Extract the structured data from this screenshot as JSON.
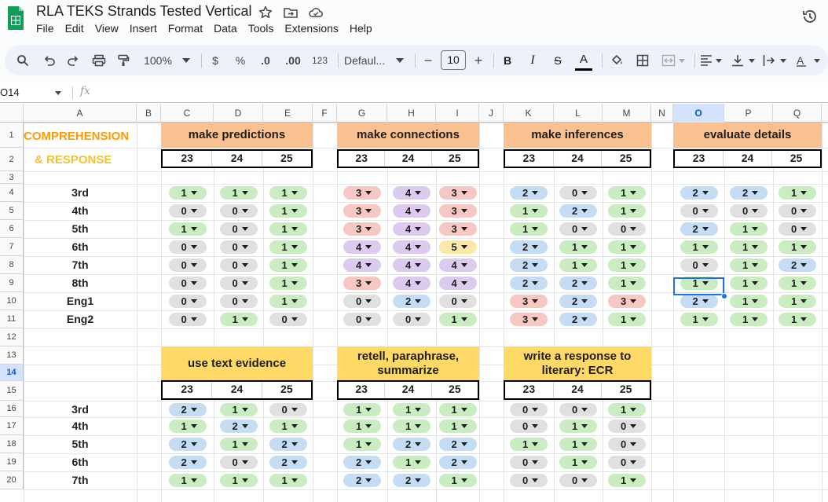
{
  "app": {
    "title": "RLA TEKS Strands Tested Vertical",
    "menus": [
      "File",
      "Edit",
      "View",
      "Insert",
      "Format",
      "Data",
      "Tools",
      "Extensions",
      "Help"
    ]
  },
  "toolbar": {
    "zoom": "100%",
    "currency": "$",
    "percent": "%",
    "dec_decrease": ".0",
    "dec_increase": ".00",
    "number_format": "123",
    "font": "Defaul...",
    "font_size": "10",
    "minus": "−",
    "plus": "+",
    "bold": "B",
    "italic": "I",
    "strike": "S",
    "text_color": "A"
  },
  "formula_bar": {
    "name_box": "O14",
    "fx": "fx"
  },
  "columns": [
    "A",
    "B",
    "C",
    "D",
    "E",
    "F",
    "G",
    "H",
    "I",
    "J",
    "K",
    "L",
    "M",
    "N",
    "O",
    "P",
    "Q"
  ],
  "selected_column": "O",
  "rows": [
    "1",
    "2",
    "3",
    "4",
    "5",
    "6",
    "7",
    "8",
    "9",
    "10",
    "11",
    "12",
    "13",
    "14",
    "15",
    "16",
    "17",
    "18",
    "19",
    "20"
  ],
  "selected_row": "14",
  "section_title": {
    "line1": "COMPREHENSION",
    "line2": "& RESPONSE"
  },
  "years": [
    "23",
    "24",
    "25"
  ],
  "groups_top": [
    "make predictions",
    "make connections",
    "make inferences",
    "evaluate details"
  ],
  "groups_bottom": [
    "use text evidence",
    "retell, paraphrase, summarize",
    "write a response to literary: ECR"
  ],
  "grades_top": [
    "3rd",
    "4th",
    "5th",
    "6th",
    "7th",
    "8th",
    "Eng1",
    "Eng2"
  ],
  "grades_bottom": [
    "3rd",
    "4th",
    "5th",
    "6th",
    "7th"
  ],
  "colors": {
    "group_orange": "#f9c18f",
    "group_yellow": "#ffd966",
    "title_orange": "#ff9900",
    "title_yellow": "#f1c232",
    "selection": "#1a73e8"
  },
  "values_top": [
    [
      "1",
      "1",
      "1",
      "3",
      "4",
      "3",
      "2",
      "0",
      "1",
      "2",
      "2",
      "1"
    ],
    [
      "0",
      "0",
      "1",
      "3",
      "4",
      "3",
      "1",
      "2",
      "1",
      "0",
      "0",
      "0"
    ],
    [
      "1",
      "0",
      "1",
      "3",
      "4",
      "3",
      "1",
      "0",
      "0",
      "2",
      "1",
      "0"
    ],
    [
      "0",
      "0",
      "1",
      "4",
      "4",
      "5",
      "2",
      "1",
      "1",
      "1",
      "1",
      "1"
    ],
    [
      "0",
      "0",
      "1",
      "4",
      "4",
      "4",
      "2",
      "1",
      "1",
      "0",
      "1",
      "2"
    ],
    [
      "0",
      "0",
      "1",
      "3",
      "4",
      "4",
      "2",
      "2",
      "1",
      "1",
      "1",
      "1"
    ],
    [
      "0",
      "0",
      "1",
      "0",
      "2",
      "0",
      "3",
      "2",
      "3",
      "2",
      "1",
      "1"
    ],
    [
      "0",
      "1",
      "0",
      "0",
      "0",
      "1",
      "3",
      "2",
      "1",
      "1",
      "1",
      "1"
    ]
  ],
  "values_bottom": [
    [
      "2",
      "1",
      "0",
      "1",
      "1",
      "1",
      "0",
      "0",
      "1"
    ],
    [
      "1",
      "2",
      "1",
      "1",
      "1",
      "1",
      "0",
      "1",
      "0"
    ],
    [
      "2",
      "1",
      "2",
      "1",
      "2",
      "2",
      "1",
      "1",
      "0"
    ],
    [
      "2",
      "0",
      "2",
      "2",
      "1",
      "2",
      "0",
      "1",
      "0"
    ],
    [
      "1",
      "1",
      "1",
      "2",
      "2",
      "1",
      "0",
      "0",
      "1"
    ]
  ]
}
